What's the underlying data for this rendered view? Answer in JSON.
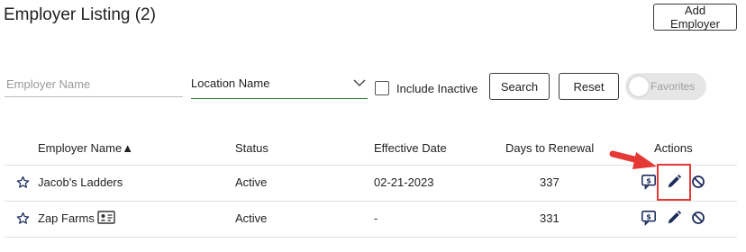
{
  "header": {
    "title": "Employer Listing (2)",
    "add_button": "Add Employer"
  },
  "filters": {
    "employer_name_placeholder": "Employer Name",
    "location_select": "Location Name",
    "include_inactive_label": "Include Inactive",
    "include_inactive_checked": false,
    "search_button": "Search",
    "reset_button": "Reset",
    "favorites_toggle": "Favorites",
    "favorites_on": false
  },
  "table": {
    "columns": [
      "Employer Name▲",
      "Status",
      "Effective Date",
      "Days to Renewal",
      "Actions"
    ],
    "rows": [
      {
        "name": "Jacob's Ladders",
        "status": "Active",
        "effective_date": "02-21-2023",
        "days_to_renewal": "337"
      },
      {
        "name": "Zap Farms",
        "status": "Active",
        "effective_date": "-",
        "days_to_renewal": "331"
      }
    ]
  },
  "icons": {
    "favorite": "star-outline-icon",
    "contact_card": "contact-card-icon",
    "billing": "billing-comment-icon",
    "edit": "pencil-icon",
    "deactivate": "block-icon"
  },
  "colors": {
    "accent_underline": "#2e7d32",
    "highlight": "#e53935",
    "action_icon": "#1c2c5b"
  }
}
